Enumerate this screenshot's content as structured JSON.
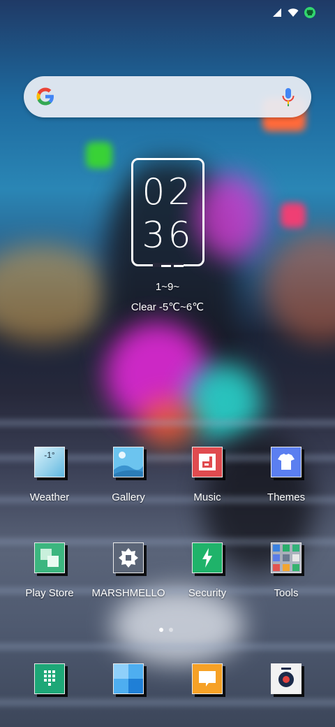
{
  "clock": {
    "hours": "02",
    "minutes": "36"
  },
  "date": "1~9~",
  "weather": "Clear -5℃~6℃",
  "weather_widget_temp": "-1°",
  "apps_row1": [
    {
      "label": "Weather",
      "icon": "weather-icon"
    },
    {
      "label": "Gallery",
      "icon": "gallery-icon"
    },
    {
      "label": "Music",
      "icon": "music-icon"
    },
    {
      "label": "Themes",
      "icon": "themes-icon"
    }
  ],
  "apps_row2": [
    {
      "label": "Play Store",
      "icon": "play-store-icon"
    },
    {
      "label": "MARSHMELLO",
      "icon": "marshmello-icon"
    },
    {
      "label": "Security",
      "icon": "security-icon"
    },
    {
      "label": "Tools",
      "icon": "tools-icon"
    }
  ],
  "dock": [
    {
      "icon": "phone-dialer-icon"
    },
    {
      "icon": "files-icon"
    },
    {
      "icon": "messages-icon"
    },
    {
      "icon": "camera-icon"
    }
  ],
  "colors": {
    "weather": "#9ad3ec",
    "gallery": "#4fb1e6",
    "music": "#e04b4f",
    "themes": "#5b7ff0",
    "play_store": "#3cb67f",
    "marshmello": "#5b6577",
    "security": "#1fb36a",
    "dialer": "#1da777",
    "messages": "#f6a126"
  }
}
